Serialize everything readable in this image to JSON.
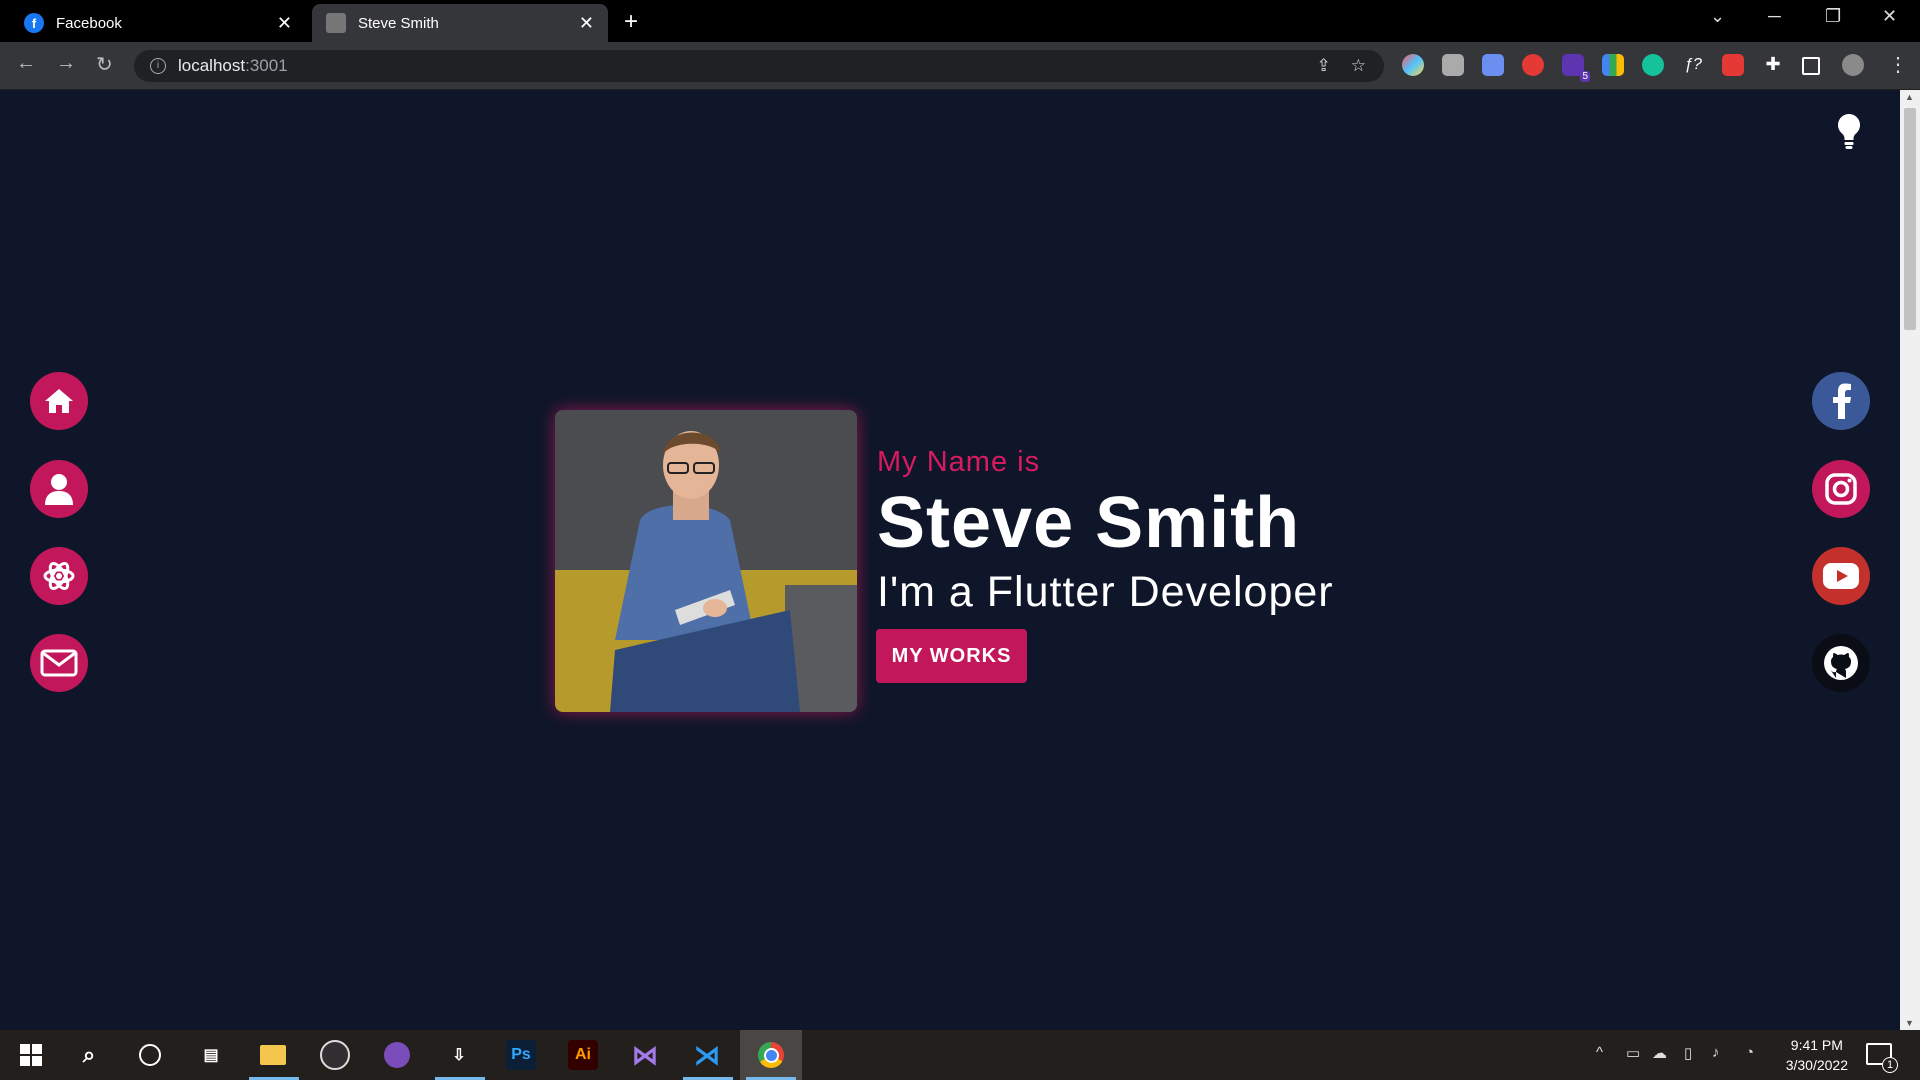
{
  "browser": {
    "tabs": [
      {
        "title": "Facebook"
      },
      {
        "title": "Steve Smith"
      }
    ],
    "address": {
      "host": "localhost",
      "port": ":3001"
    }
  },
  "page": {
    "subtitle": "My Name is",
    "name": "Steve Smith",
    "role": "I'm a Flutter Developer",
    "cta_label": "MY WORKS",
    "left_nav": [
      "home-icon",
      "user-icon",
      "atom-icon",
      "mail-icon"
    ],
    "social": [
      "facebook-icon",
      "instagram-icon",
      "youtube-icon",
      "github-icon"
    ],
    "colors": {
      "background": "#0f1629",
      "accent": "#c2185b",
      "facebook": "#3b5998",
      "youtube": "#c4302b"
    }
  },
  "taskbar": {
    "time": "9:41 PM",
    "date": "3/30/2022",
    "notifications": "1",
    "extension_badge": "5"
  }
}
